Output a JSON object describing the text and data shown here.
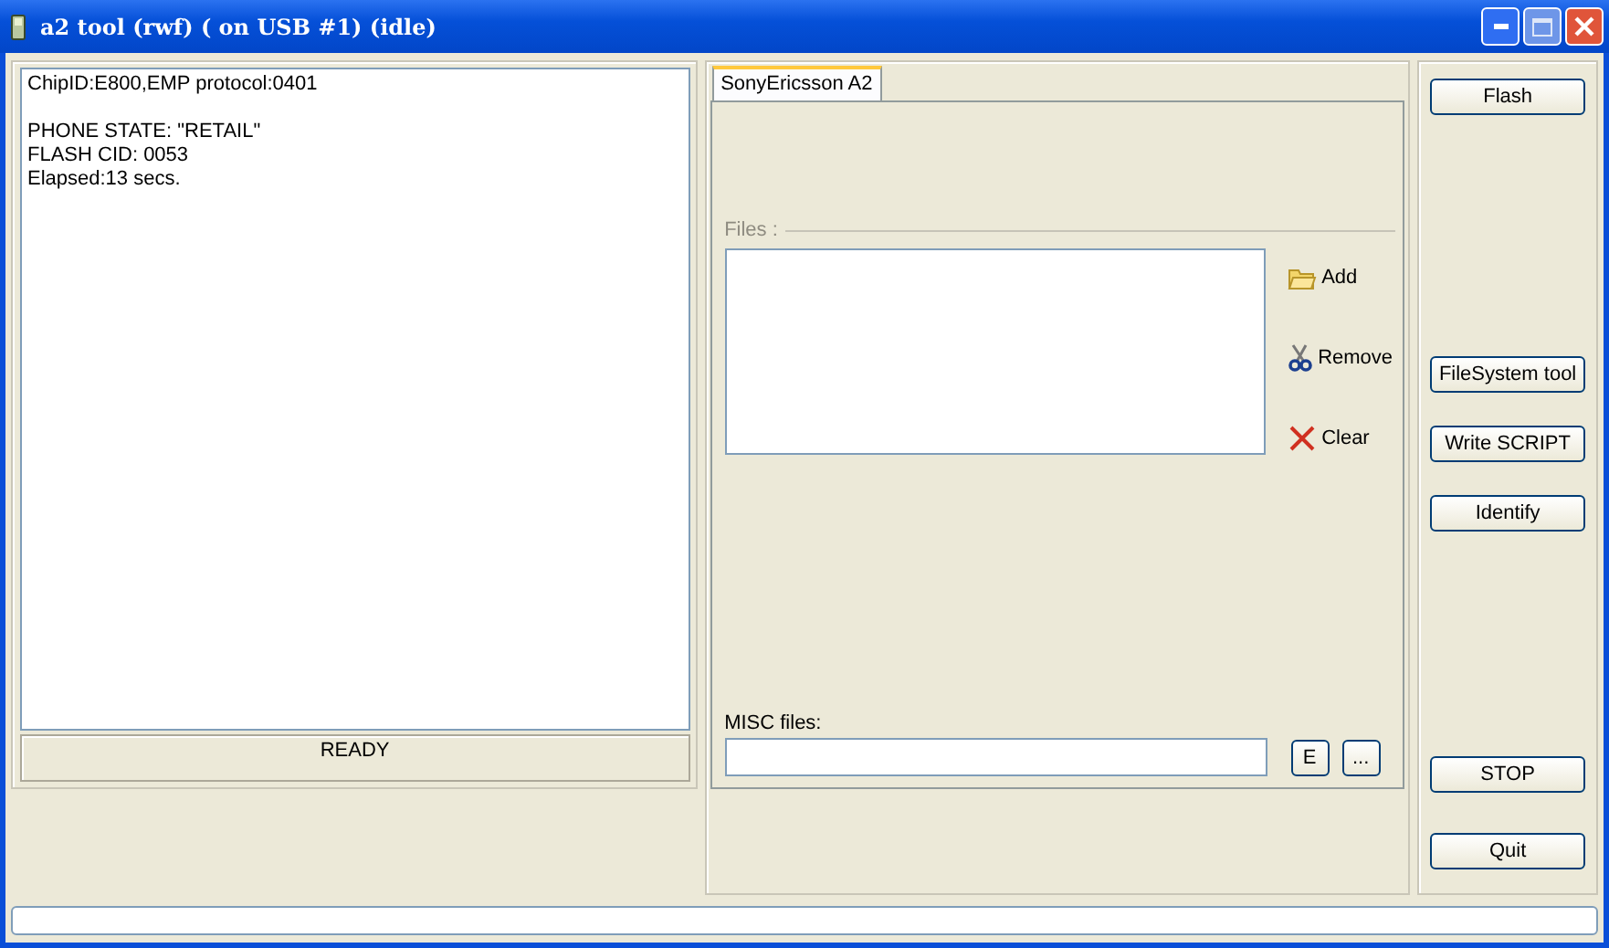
{
  "window": {
    "title": "a2 tool (rwf) ( on USB #1) (idle)"
  },
  "log_blocks": [
    {
      "lines": [
        "ChipID:E800,EMP protocol:0401"
      ]
    },
    {
      "lines": [
        "PHONE STATE: \"RETAIL\"",
        "FLASH CID: 0053",
        "Elapsed:13 secs."
      ]
    }
  ],
  "status": "READY",
  "tabs": [
    {
      "label": "SonyEricsson A2",
      "selected": true
    }
  ],
  "files": {
    "label": "Files :",
    "buttons": [
      {
        "label": "Add",
        "kind": "add"
      },
      {
        "label": "Remove",
        "kind": "remove"
      },
      {
        "label": "Clear",
        "kind": "clear"
      }
    ]
  },
  "misc": {
    "label": "MISC files:",
    "buttons": [
      "E",
      "..."
    ]
  },
  "side_buttons": [
    "Flash",
    "FileSystem tool",
    "Write SCRIPT",
    "Identify",
    "STOP",
    "Quit"
  ],
  "progress": {
    "level": 0
  }
}
